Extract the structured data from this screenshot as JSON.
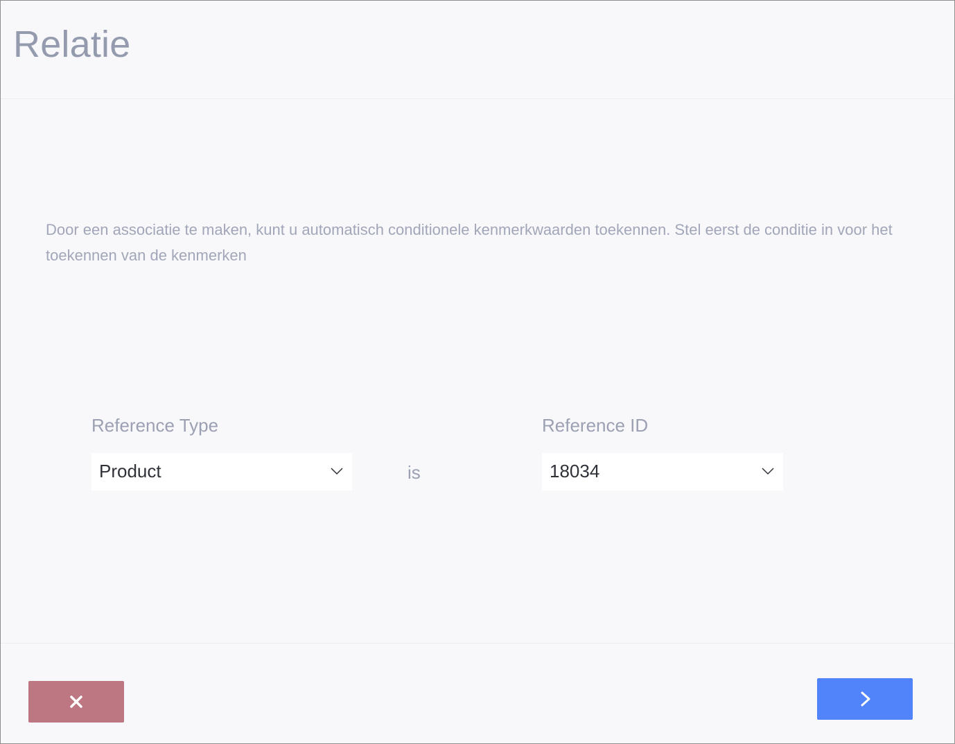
{
  "modal": {
    "title": "Relatie",
    "description": "Door een associatie te maken, kunt u automatisch conditionele kenmerkwaarden toekennen. Stel eerst de conditie in voor het toekennen van de kenmerken"
  },
  "condition": {
    "reference_type": {
      "label": "Reference Type",
      "value": "Product"
    },
    "operator": "is",
    "reference_id": {
      "label": "Reference ID",
      "value": "18034"
    }
  },
  "footer": {
    "cancel_icon": "close-icon",
    "next_icon": "chevron-right-icon"
  },
  "colors": {
    "cancel_button": "#bd7783",
    "next_button": "#5184fb",
    "background": "#f8f8fb",
    "muted_text": "#9ba0b2"
  }
}
